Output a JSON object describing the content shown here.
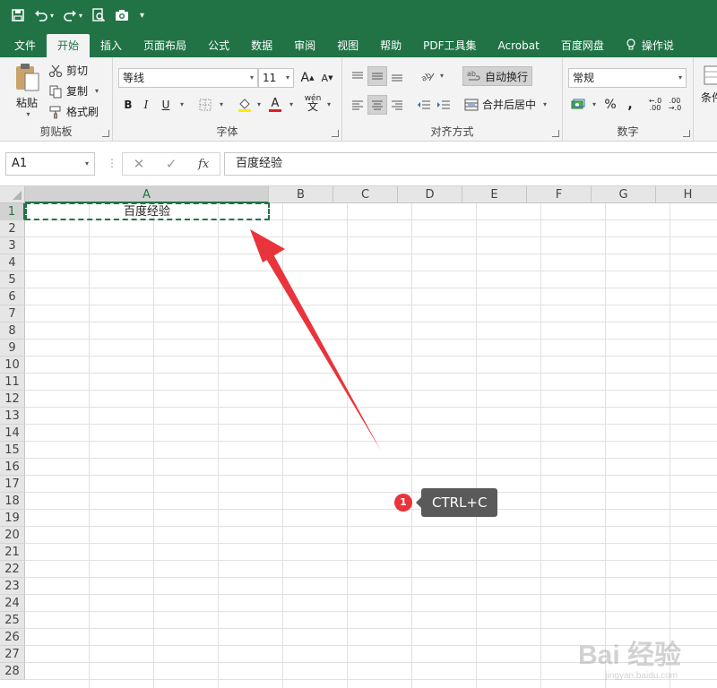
{
  "quick_access": {
    "items": [
      "save-icon",
      "undo-icon",
      "redo-icon",
      "print-preview-icon",
      "camera-icon",
      "customize-icon"
    ]
  },
  "tabs": [
    "文件",
    "开始",
    "插入",
    "页面布局",
    "公式",
    "数据",
    "审阅",
    "视图",
    "帮助",
    "PDF工具集",
    "Acrobat",
    "百度网盘",
    "操作说"
  ],
  "active_tab": "开始",
  "ribbon": {
    "clipboard": {
      "label": "剪贴板",
      "paste": "粘贴",
      "cut": "剪切",
      "copy": "复制",
      "format_painter": "格式刷"
    },
    "font": {
      "label": "字体",
      "font_name": "等线",
      "font_size": "11",
      "bold": "B",
      "italic": "I",
      "underline": "U",
      "grow": "A",
      "shrink": "A",
      "font_color": "A",
      "phonetic": "wén"
    },
    "alignment": {
      "label": "对齐方式",
      "wrap_text": "自动换行",
      "merge_center": "合并后居中"
    },
    "number": {
      "label": "数字",
      "format": "常规",
      "percent": "%",
      "comma": ",",
      "inc_decimal": ".00",
      "dec_decimal": ".0"
    },
    "styles": {
      "label": "条件"
    }
  },
  "formula_bar": {
    "name_box": "A1",
    "cancel": "✕",
    "enter": "✓",
    "fx": "fx",
    "content": "百度经验"
  },
  "sheet": {
    "columns": [
      "A",
      "B",
      "C",
      "D",
      "E",
      "F",
      "G",
      "H"
    ],
    "rows": [
      "1",
      "2",
      "3",
      "4",
      "5",
      "6",
      "7",
      "8",
      "9",
      "10",
      "11",
      "12",
      "13",
      "14",
      "15",
      "16",
      "17",
      "18",
      "19",
      "20",
      "21",
      "22",
      "23",
      "24",
      "25",
      "26",
      "27",
      "28"
    ],
    "selected_column": "A",
    "selected_row": "1",
    "cell_a1": "百度经验"
  },
  "annotation": {
    "step": "1",
    "shortcut": "CTRL+C",
    "color": "#e8343a"
  },
  "watermark": {
    "text": "Bai 经验",
    "sub": "jingyan.baidu.com"
  },
  "colors": {
    "excel_green": "#217346",
    "ribbon_bg": "#f3f3f3"
  }
}
